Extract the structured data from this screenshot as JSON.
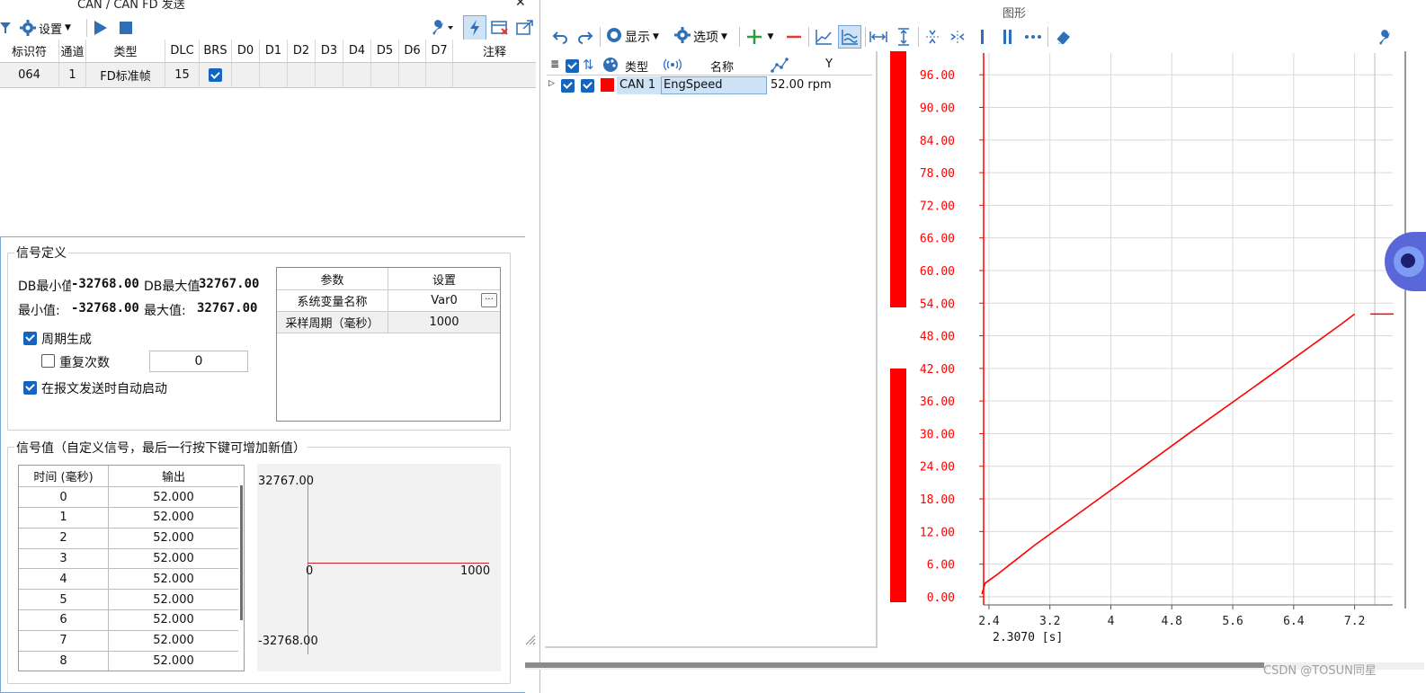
{
  "left_window": {
    "title": "CAN / CAN FD 发送",
    "toolbar": {
      "settings_label": "设置"
    },
    "grid": {
      "headers": [
        "标识符",
        "通道",
        "类型",
        "DLC",
        "BRS",
        "D0",
        "D1",
        "D2",
        "D3",
        "D4",
        "D5",
        "D6",
        "D7",
        "注释"
      ],
      "row": {
        "id": "064",
        "channel": "1",
        "type": "FD标准帧",
        "dlc": "15"
      }
    },
    "signal_definition": {
      "title": "信号定义",
      "db_min_label": "DB最小值",
      "db_min_value": "-32768.00",
      "db_max_label": "DB最大值",
      "db_max_value": "32767.00",
      "min_label": "最小值:",
      "min_value": "-32768.00",
      "max_label": "最大值:",
      "max_value": "32767.00",
      "periodic_label": "周期生成",
      "repeat_label": "重复次数",
      "repeat_value": "0",
      "autostart_label": "在报文发送时自动启动",
      "params": {
        "header_param": "参数",
        "header_setting": "设置",
        "rows": [
          {
            "name": "系统变量名称",
            "value": "Var0",
            "button": "···"
          },
          {
            "name": "采样周期（毫秒）",
            "value": "1000"
          }
        ]
      }
    },
    "signal_values": {
      "title": "信号值（自定义信号，最后一行按下键可增加新值）",
      "col_time": "时间 (毫秒)",
      "col_output": "输出",
      "rows": [
        {
          "time": "0",
          "output": "52.000"
        },
        {
          "time": "1",
          "output": "52.000"
        },
        {
          "time": "2",
          "output": "52.000"
        },
        {
          "time": "3",
          "output": "52.000"
        },
        {
          "time": "4",
          "output": "52.000"
        },
        {
          "time": "5",
          "output": "52.000"
        },
        {
          "time": "6",
          "output": "52.000"
        },
        {
          "time": "7",
          "output": "52.000"
        },
        {
          "time": "8",
          "output": "52.000"
        }
      ],
      "preview": {
        "y_top": "32767.00",
        "y_bottom": "-32768.00",
        "x_left": "0",
        "x_right": "1000"
      }
    }
  },
  "right_window": {
    "title": "图形",
    "toolbar": {
      "display_label": "显示",
      "options_label": "选项"
    },
    "legend": {
      "headers": {
        "type": "类型",
        "name": "名称",
        "y": "Y"
      },
      "row": {
        "type": "CAN 1",
        "name": "EngSpeed",
        "y": "52.00 rpm",
        "color": "#ff0000"
      }
    },
    "chart": {
      "y_ticks": [
        "96.00",
        "90.00",
        "84.00",
        "78.00",
        "72.00",
        "66.00",
        "60.00",
        "54.00",
        "48.00",
        "42.00",
        "36.00",
        "30.00",
        "24.00",
        "18.00",
        "12.00",
        "6.00",
        "0.00"
      ],
      "x_ticks": [
        "2.4",
        "3.2",
        "4",
        "4.8",
        "5.6",
        "6.4",
        "7.2"
      ],
      "cursor_label": "2.3070 [s]",
      "series_color": "#ff0000"
    }
  },
  "chart_data": {
    "type": "line",
    "xlabel": "[s]",
    "ylabel": "",
    "xlim": [
      2.33,
      7.7
    ],
    "ylim": [
      -1.5,
      100
    ],
    "series": [
      {
        "name": "EngSpeed",
        "color": "#ff0000",
        "x": [
          2.307,
          2.35,
          2.5,
          3.0,
          4.0,
          5.0,
          6.0,
          7.0,
          7.2
        ],
        "y": [
          0.5,
          2.5,
          4.0,
          9.5,
          19.6,
          29.8,
          39.8,
          49.9,
          52.0
        ]
      }
    ]
  },
  "watermark": "CSDN @TOSUN同星"
}
